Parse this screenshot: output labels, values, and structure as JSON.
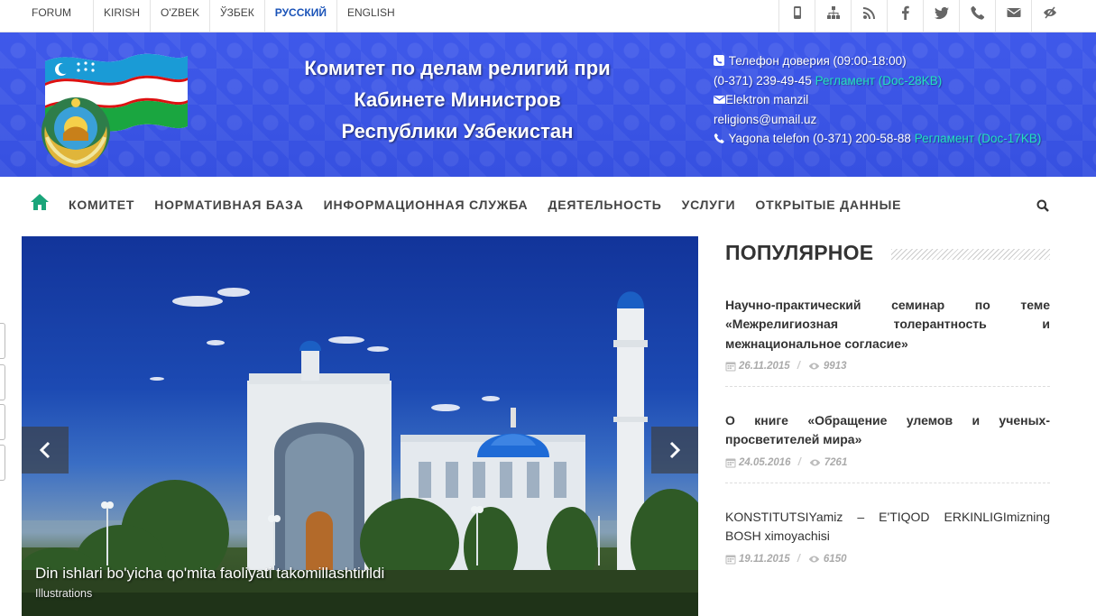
{
  "topbar": {
    "forum": "FORUM",
    "languages": [
      "KIRISH",
      "O'ZBEK",
      "ЎЗБЕК",
      "РУССКИЙ",
      "ENGLISH"
    ],
    "active_language": "РУССКИЙ",
    "icons": [
      "mobile-icon",
      "sitemap-icon",
      "rss-icon",
      "facebook-icon",
      "twitter-icon",
      "phone-icon",
      "mail-icon",
      "low-vision-icon"
    ]
  },
  "header": {
    "title_lines": [
      "Комитет по делам религий при",
      "Кабинете Министров",
      "Республики Узбекистан"
    ],
    "contacts": {
      "hotline_label": "Телефон доверия (09:00-18:00)",
      "hotline_number": "(0-371) 239-49-45",
      "hotline_link": "Регламент (Doc-28KB)",
      "email_label": "Elektron manzil",
      "email": "religions@umail.uz",
      "single_phone": "Yagona telefon (0-371) 200-58-88",
      "single_phone_link": "Регламент (Doc-17KB)"
    },
    "colors": {
      "banner": "#3c55e6",
      "link": "#22e0c0"
    }
  },
  "nav": {
    "items": [
      "КОМИТЕТ",
      "НОРМАТИВНАЯ БАЗА",
      "ИНФОРМАЦИОННАЯ СЛУЖБА",
      "ДЕЯТЕЛЬНОСТЬ",
      "УСЛУГИ",
      "ОТКРЫТЫЕ ДАННЫЕ"
    ],
    "accent": "#1aa57a"
  },
  "slider": {
    "caption": "Din ishlari bo'yicha qo'mita faoliyati takomillashtirildi",
    "subcaption": "Illustrations"
  },
  "popular": {
    "heading": "ПОПУЛЯРНОЕ",
    "posts": [
      {
        "title": "Научно-практический семинар по теме «Межрелигиозная толерантность и межнациональное согласие»",
        "date": "26.11.2015",
        "views": "9913"
      },
      {
        "title": "О книге «Обращение улемов и ученых-просветителей мира»",
        "date": "24.05.2016",
        "views": "7261"
      },
      {
        "title": "KONSTITUTSIYamiz – E'TIQOD ERKINLIGImizning BOSH ximoyachisi",
        "date": "19.11.2015",
        "views": "6150"
      }
    ]
  }
}
